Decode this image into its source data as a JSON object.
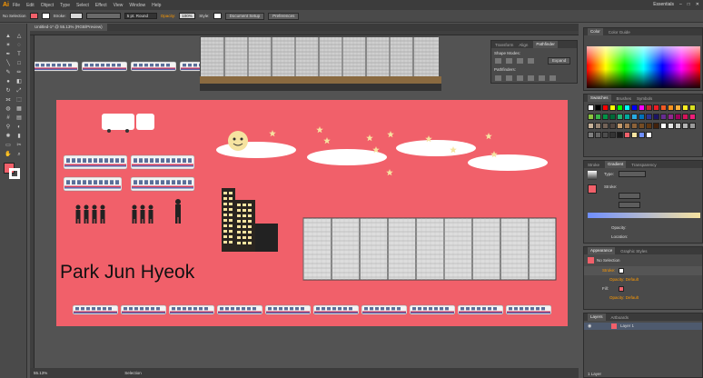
{
  "app": {
    "logo": "Ai",
    "workspace": "Essentials"
  },
  "menu": [
    "File",
    "Edit",
    "Object",
    "Type",
    "Select",
    "Effect",
    "View",
    "Window",
    "Help"
  ],
  "control": {
    "selection": "No Selection",
    "stroke_label": "Stroke:",
    "brush": "5 pt. Round",
    "opacity_label": "Opacity:",
    "opacity_value": "100%",
    "style_label": "Style:",
    "document_setup": "Document Setup",
    "preferences": "Preferences"
  },
  "document": {
    "tab": "Untitled-1* @ 55.13% (RGB/Preview)",
    "zoom": "55.13%"
  },
  "status": {
    "zoom": "55.13%",
    "mode": "Selection"
  },
  "artwork": {
    "title_text": "Park Jun Hyeok"
  },
  "colors": {
    "artboard": "#f1606a",
    "ui_dark": "#3c3c3c",
    "ui_mid": "#4a4a4a",
    "canvas": "#535353",
    "accent_orange": "#ff9a00"
  },
  "panels": {
    "color": {
      "tabs": [
        "Color",
        "Color Guide"
      ]
    },
    "transform": {
      "tabs": [
        "Transform",
        "Align",
        "Pathfinder"
      ],
      "shape_modes": "Shape Modes:",
      "pathfinders": "Pathfinders:",
      "expand": "Expand"
    },
    "swatches": {
      "tabs": [
        "Swatches",
        "Brushes",
        "Symbols"
      ]
    },
    "gradient": {
      "tabs": [
        "Stroke",
        "Gradient",
        "Transparency"
      ],
      "type_label": "Type:",
      "stroke_label": "Stroke:",
      "angle_label": "",
      "opacity_label": "Opacity:",
      "location_label": "Location:"
    },
    "appearance": {
      "tabs": [
        "Appearance",
        "Graphic Styles"
      ],
      "selection": "No Selection",
      "stroke_label": "Stroke:",
      "opacity1": "Opacity: Default",
      "fill_label": "Fill:",
      "opacity2": "Opacity: Default"
    },
    "layers": {
      "tabs": [
        "Layers",
        "Artboards"
      ],
      "layer_name": "Layer 1",
      "count": "1 Layer"
    }
  }
}
